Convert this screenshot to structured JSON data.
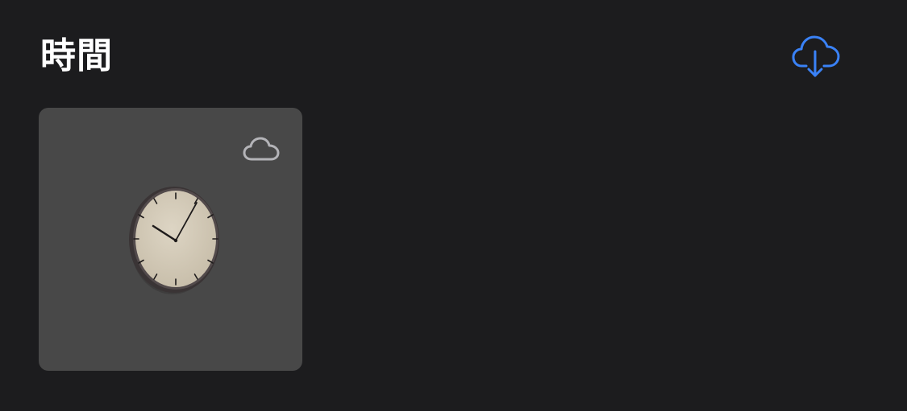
{
  "header": {
    "title": "時間"
  },
  "icons": {
    "download": "cloud-download-icon",
    "card_cloud": "cloud-icon",
    "clock": "wall-clock"
  },
  "colors": {
    "background": "#1c1c1e",
    "card": "#484848",
    "accent": "#3a82f7",
    "cloud_outline": "#b4b4b8",
    "clock_face": "#d2c9b8",
    "clock_bezel": "#3a3435"
  }
}
